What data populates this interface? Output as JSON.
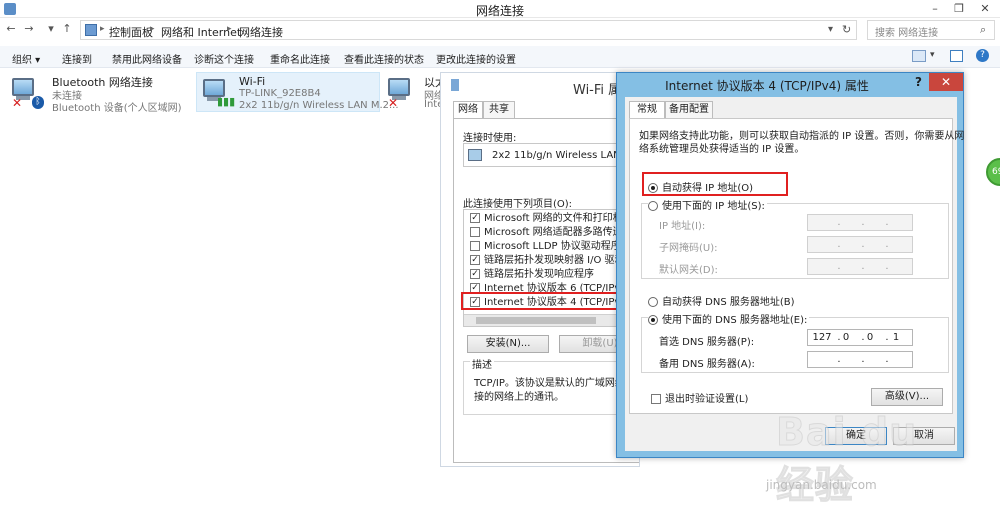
{
  "window": {
    "title": "网络连接",
    "controls": [
      "–",
      "❐",
      "✕"
    ]
  },
  "address": {
    "crumbs": [
      "控制面板",
      "网络和 Internet",
      "网络连接"
    ],
    "search_placeholder": "搜索 网络连接"
  },
  "commands": [
    "组织 ▾",
    "连接到",
    "禁用此网络设备",
    "诊断这个连接",
    "重命名此连接",
    "查看此连接的状态",
    "更改此连接的设置"
  ],
  "adapters": [
    {
      "name": "Bluetooth 网络连接",
      "status": "未连接",
      "device": "Bluetooth 设备(个人区域网)"
    },
    {
      "name": "Wi-Fi",
      "status": "TP-LINK_92E8B4",
      "device": "2x2 11b/g/n Wireless LAN M.2..."
    },
    {
      "name": "以太",
      "status": "网络",
      "device": "Inte"
    }
  ],
  "wifi_dialog": {
    "title": "Wi-Fi 属",
    "tabs": [
      "网络",
      "共享"
    ],
    "connect_using_label": "连接时使用:",
    "adapter": "2x2 11b/g/n Wireless LAN M.",
    "items_label": "此连接使用下列项目(O):",
    "items": [
      {
        "label": "Microsoft 网络的文件和打印机",
        "checked": true
      },
      {
        "label": "Microsoft 网络适配器多路传送",
        "checked": false
      },
      {
        "label": "Microsoft LLDP 协议驱动程序",
        "checked": false
      },
      {
        "label": "链路层拓扑发现映射器 I/O 驱动",
        "checked": true
      },
      {
        "label": "链路层拓扑发现响应程序",
        "checked": true
      },
      {
        "label": "Internet 协议版本 6 (TCP/IPv6",
        "checked": true
      },
      {
        "label": "Internet 协议版本 4 (TCP/IPv4",
        "checked": true
      }
    ],
    "install_button": "安装(N)...",
    "uninstall_button": "卸载(U)",
    "description_label": "描述",
    "description_text": [
      "TCP/IP。该协议是默认的广域网络协",
      "接的网络上的通讯。"
    ]
  },
  "ipv4_dialog": {
    "title": "Internet 协议版本 4 (TCP/IPv4) 属性",
    "help": "?",
    "close": "✕",
    "tabs": [
      "常规",
      "备用配置"
    ],
    "intro": [
      "如果网络支持此功能，则可以获取自动指派的 IP 设置。否则，你需要从网",
      "络系统管理员处获得适当的 IP 设置。"
    ],
    "auto_ip": "自动获得 IP 地址(O)",
    "manual_ip": "使用下面的 IP 地址(S):",
    "ip_address_label": "IP 地址(I):",
    "subnet_label": "子网掩码(U):",
    "gateway_label": "默认网关(D):",
    "auto_dns": "自动获得 DNS 服务器地址(B)",
    "manual_dns": "使用下面的 DNS 服务器地址(E):",
    "preferred_dns_label": "首选 DNS 服务器(P):",
    "preferred_dns_octets": [
      "127",
      "0",
      "0",
      "1"
    ],
    "alternate_dns_label": "备用 DNS 服务器(A):",
    "validate_label": "退出时验证设置(L)",
    "advanced_button": "高级(V)...",
    "ok_button": "确定",
    "cancel_button": "取消"
  },
  "watermark": {
    "brand": "Bai du 经验",
    "url": "jingyan.baidu.com"
  },
  "badge": "69"
}
